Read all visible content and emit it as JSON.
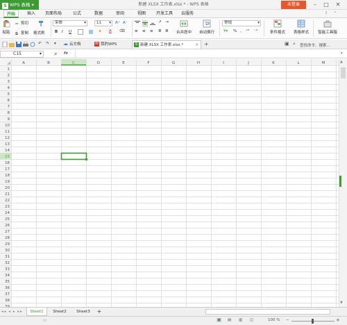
{
  "titlebar": {
    "app_name": "WPS 表格",
    "doc_title": "新建 XLSX 工作表.xlsx * - WPS 表格",
    "login": "未登录"
  },
  "menu_tabs": [
    "开始",
    "插入",
    "页面布局",
    "公式",
    "数据",
    "审阅",
    "视图",
    "开发工具",
    "云服务"
  ],
  "ribbon": {
    "paste": "粘贴",
    "cut": "剪切",
    "copy": "复制",
    "format_painter": "格式刷",
    "font_name": "宋体",
    "font_size": "11",
    "number_format": "常规",
    "merge_center": "合并居中",
    "wrap_text": "自动换行",
    "conditional_format": "条件格式",
    "table_style": "表格样式",
    "smart_toolbox": "智能工具箱",
    "bold": "B",
    "italic": "I",
    "underline": "U",
    "font_color": "A",
    "fill": "◈",
    "grow": "A⁺",
    "shrink": "A⁻",
    "percent": "%",
    "comma": ","
  },
  "quickbar": {
    "tabs": [
      {
        "label": "云文档"
      },
      {
        "label": "我的WPS"
      },
      {
        "label": "新建 XLSX 工作表.xlsx *"
      }
    ],
    "search": "查找命令、搜索..."
  },
  "formulabar": {
    "cell_ref": "C15",
    "fx": "fx"
  },
  "grid": {
    "columns": [
      "A",
      "B",
      "C",
      "D",
      "E",
      "F",
      "G",
      "H",
      "I",
      "J",
      "K",
      "L",
      "M"
    ],
    "row_count": 39,
    "selected_cell": {
      "col": "C",
      "row": 15
    },
    "accent": "#3d9a35",
    "header_bg": "#f3f3f3",
    "selected_header_bg": "#cde7c6",
    "line_color": "#e1e1e1"
  },
  "sheets": [
    "Sheet1",
    "Sheet2",
    "Sheet3"
  ],
  "active_sheet": "Sheet1",
  "status": {
    "zoom": "100 %"
  }
}
